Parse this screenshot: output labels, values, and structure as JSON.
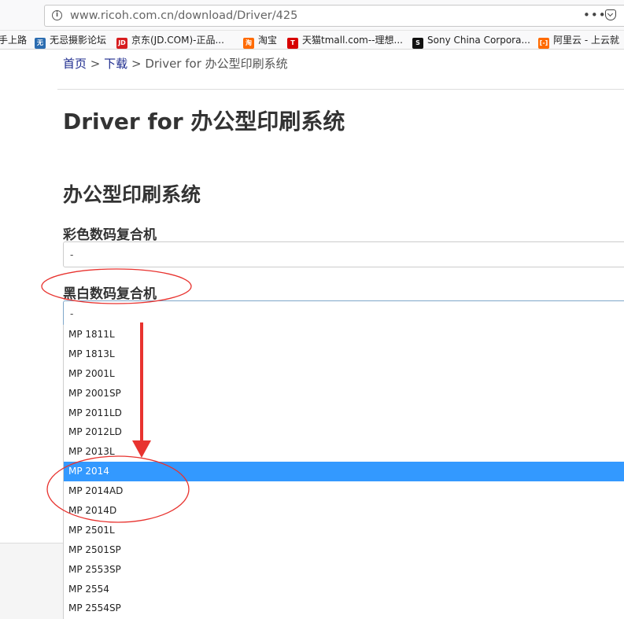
{
  "browser": {
    "url": "www.ricoh.com.cn/download/Driver/425",
    "more_icon": "more-actions-icon",
    "pocket_icon": "pocket-icon",
    "bookmarks": [
      {
        "label": "手上路",
        "icon": "bookmark-favicon",
        "color": ""
      },
      {
        "label": "无忌摄影论坛",
        "icon": "wuji-favicon",
        "color": "#2b6cb0"
      },
      {
        "label": "京东(JD.COM)-正品...",
        "icon": "jd-favicon",
        "color": "#d71c1e"
      },
      {
        "label": "淘宝",
        "icon": "taobao-favicon",
        "color": "#ff6a00"
      },
      {
        "label": "天猫tmall.com--理想...",
        "icon": "tmall-favicon",
        "color": "#d70000"
      },
      {
        "label": "Sony China Corpora...",
        "icon": "sony-favicon",
        "color": "#111111"
      },
      {
        "label": "阿里云 - 上云就",
        "icon": "aliyun-favicon",
        "color": "#ff6a00"
      }
    ]
  },
  "breadcrumb": {
    "home": "首页",
    "sep1": ">",
    "download": "下载",
    "sep2": ">",
    "current": "Driver for 办公型印刷系统"
  },
  "page_title": "Driver for 办公型印刷系统",
  "section_title": "办公型印刷系统",
  "color_mfp": {
    "label": "彩色数码复合机",
    "value": "-"
  },
  "bw_mfp": {
    "label": "黑白数码复合机",
    "value": "-",
    "options": [
      "MP 1811L",
      "MP 1813L",
      "MP 2001L",
      "MP 2001SP",
      "MP 2011LD",
      "MP 2012LD",
      "MP 2013L",
      "MP 2014",
      "MP 2014AD",
      "MP 2014D",
      "MP 2501L",
      "MP 2501SP",
      "MP 2553SP",
      "MP 2554",
      "MP 2554SP"
    ],
    "selected": "MP 2014"
  },
  "colors": {
    "link": "#1d2b8e",
    "selection": "#3399ff",
    "annotation": "#e8332f"
  }
}
